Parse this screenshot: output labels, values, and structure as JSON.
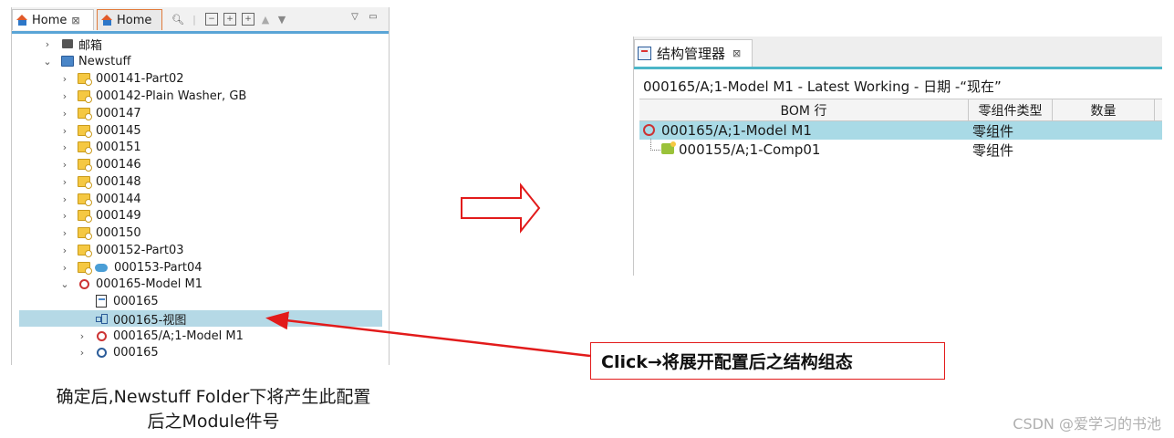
{
  "left_panel": {
    "tabs": [
      {
        "label": "Home",
        "close": "⊠"
      },
      {
        "label": "Home"
      }
    ],
    "toolbar_icons": [
      "search-icon",
      "collapse-all-icon",
      "expand-icon",
      "expand-all-icon",
      "up-arrow-icon",
      "down-arrow-icon",
      "view-menu-icon",
      "minimize-icon"
    ],
    "tree": [
      {
        "label": "邮箱",
        "icon": "mailbox-icon",
        "chevron": "›"
      },
      {
        "label": "Newstuff",
        "icon": "newstuff-folder-icon",
        "chevron": "⌄"
      },
      {
        "label": "000141-Part02",
        "icon": "item-folder-icon",
        "chevron": "›"
      },
      {
        "label": "000142-Plain Washer, GB",
        "icon": "item-folder-icon",
        "chevron": "›"
      },
      {
        "label": "000147",
        "icon": "item-folder-icon",
        "chevron": "›"
      },
      {
        "label": "000145",
        "icon": "item-folder-icon",
        "chevron": "›"
      },
      {
        "label": "000151",
        "icon": "item-folder-icon",
        "chevron": "›"
      },
      {
        "label": "000146",
        "icon": "item-folder-icon",
        "chevron": "›"
      },
      {
        "label": "000148",
        "icon": "item-folder-icon",
        "chevron": "›"
      },
      {
        "label": "000144",
        "icon": "item-folder-icon",
        "chevron": "›"
      },
      {
        "label": "000149",
        "icon": "item-folder-icon",
        "chevron": "›"
      },
      {
        "label": "000150",
        "icon": "item-folder-icon",
        "chevron": "›"
      },
      {
        "label": "000152-Part03",
        "icon": "item-folder-icon",
        "chevron": "›"
      },
      {
        "label": "000153-Part04",
        "icon": "item-folder-icon",
        "chevron": "›"
      },
      {
        "label": "000165-Model M1",
        "icon": "assembly-icon",
        "chevron": "⌄"
      },
      {
        "label": "000165",
        "icon": "document-icon",
        "chevron": ""
      },
      {
        "label": "000165-视图",
        "icon": "view-icon",
        "chevron": "",
        "selected": true
      },
      {
        "label": "000165/A;1-Model M1",
        "icon": "assembly-icon",
        "chevron": "›"
      },
      {
        "label": "000165",
        "icon": "configuration-icon",
        "chevron": "›"
      }
    ]
  },
  "caption_left": [
    "确定后,Newstuff Folder下将产生此配置",
    "后之Module件号"
  ],
  "callout": {
    "text": "Click→将展开配置后之结构组态"
  },
  "right_panel": {
    "tab": {
      "label": "结构管理器",
      "close": "⊠"
    },
    "context": "000165/A;1-Model M1 - Latest Working - 日期 -“现在”",
    "columns": [
      "BOM 行",
      "零组件类型",
      "数量"
    ],
    "rows": [
      {
        "name": "000165/A;1-Model M1",
        "type": "零组件",
        "qty": "",
        "selected": true
      },
      {
        "name": "000155/A;1-Comp01",
        "type": "零组件",
        "qty": ""
      }
    ]
  },
  "watermark": "CSDN @爱学习的书池",
  "colors": {
    "arrow": "#e21b1b",
    "selection": "#b5d9e6",
    "accent": "#4cb6c8"
  }
}
